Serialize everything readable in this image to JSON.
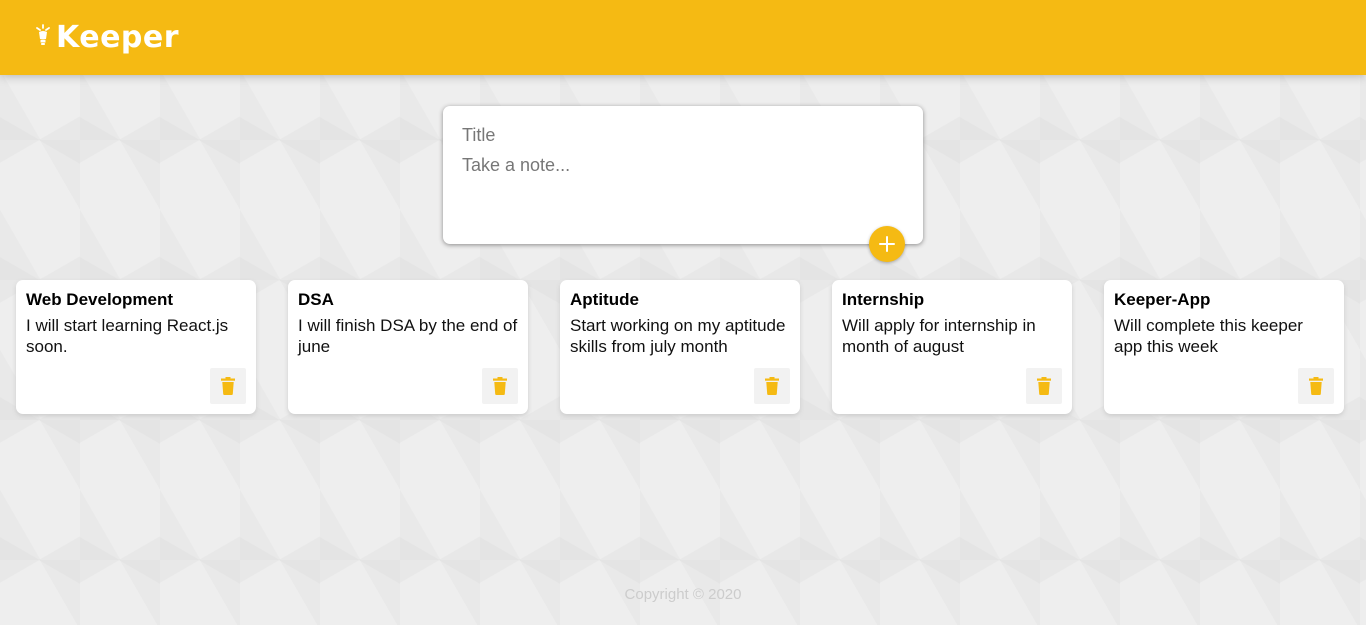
{
  "header": {
    "brand": "Keeper",
    "logo_icon": "lightbulb-icon",
    "background_color": "#f5ba13"
  },
  "create_note": {
    "title_placeholder": "Title",
    "content_placeholder": "Take a note...",
    "title_value": "",
    "content_value": "",
    "add_icon": "plus-icon"
  },
  "notes": [
    {
      "title": "Web Development",
      "content": "I will start learning React.js soon.",
      "delete_icon": "trash-icon"
    },
    {
      "title": "DSA",
      "content": "I will finish DSA by the end of june",
      "delete_icon": "trash-icon"
    },
    {
      "title": "Aptitude",
      "content": "Start working on my aptitude skills from july month",
      "delete_icon": "trash-icon"
    },
    {
      "title": "Internship",
      "content": "Will apply for internship in month of august",
      "delete_icon": "trash-icon"
    },
    {
      "title": "Keeper-App",
      "content": "Will complete this keeper app this week",
      "delete_icon": "trash-icon"
    }
  ],
  "footer": {
    "copyright": "Copyright © 2020"
  },
  "colors": {
    "accent": "#f5ba13",
    "background": "#eeeeee",
    "card": "#ffffff"
  }
}
